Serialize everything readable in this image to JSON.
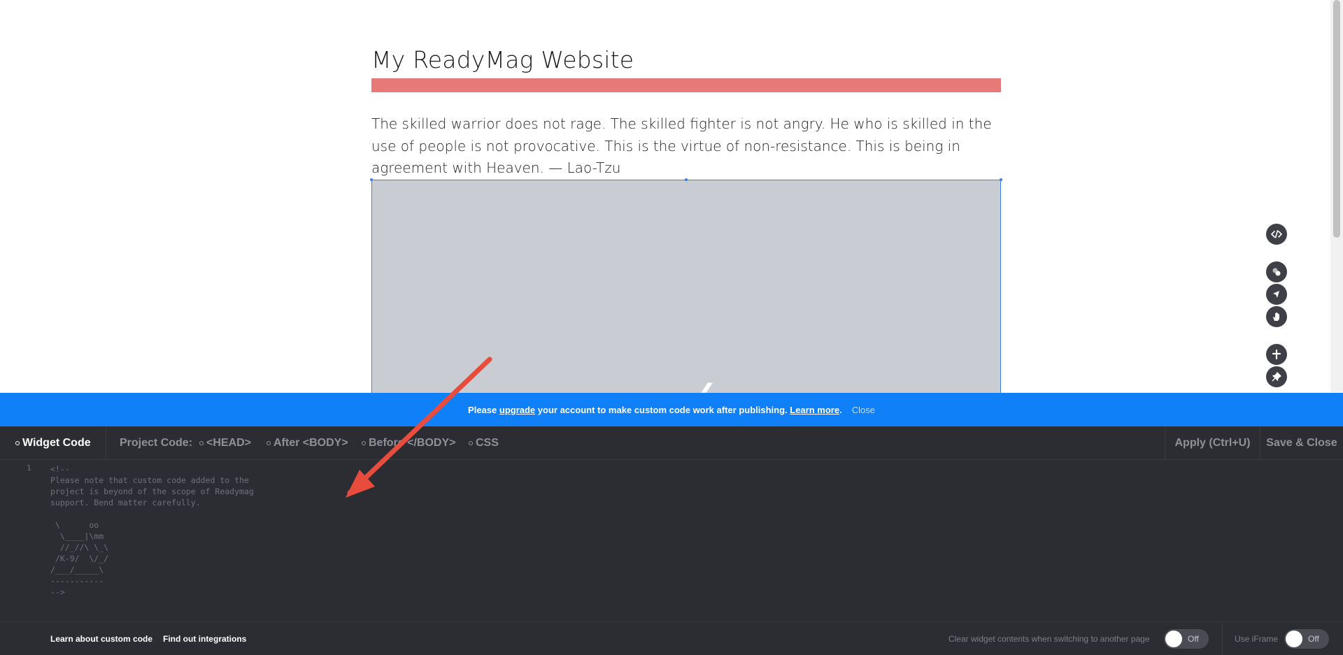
{
  "page": {
    "title": "My ReadyMag Website",
    "quote": "The skilled warrior does not rage. The skilled fighter is not angry. He who is skilled in the use of people is not provocative. This is the virtue of non-resistance. This is being in agreement with Heaven. — Lao-Tzu",
    "accent_color": "#e87979"
  },
  "toolbar": {
    "icons": [
      "code-icon",
      "layers-icon",
      "select-arrow-icon",
      "hand-icon",
      "add-icon",
      "pin-icon"
    ]
  },
  "banner": {
    "prefix": "Please",
    "upgrade_link": "upgrade",
    "middle": "your account to make custom code work after publishing.",
    "learn_more": "Learn more",
    "period": ".",
    "close": "Close",
    "color": "#0f80f7"
  },
  "panel": {
    "widget_tab": "Widget Code",
    "project_label": "Project Code:",
    "tabs": [
      "<HEAD>",
      "After <BODY>",
      "Before </BODY>",
      "CSS"
    ],
    "apply": "Apply (Ctrl+U)",
    "save_close": "Save & Close"
  },
  "editor": {
    "line_number": "1",
    "code": "<!--\nPlease note that custom code added to the\nproject is beyond of the scope of Readymag\nsupport. Bend matter carefully.\n\n \\      oo\n  \\____|\\mm\n  //_//\\ \\_\\\n /K-9/  \\/_/\n/___/_____\\\n-----------\n-->"
  },
  "footer": {
    "learn_custom_code": "Learn about custom code",
    "find_integrations": "Find out integrations",
    "clear_widget_label": "Clear widget contents when switching to another page",
    "clear_widget_state": "Off",
    "iframe_label": "Use iFrame",
    "iframe_state": "Off"
  }
}
